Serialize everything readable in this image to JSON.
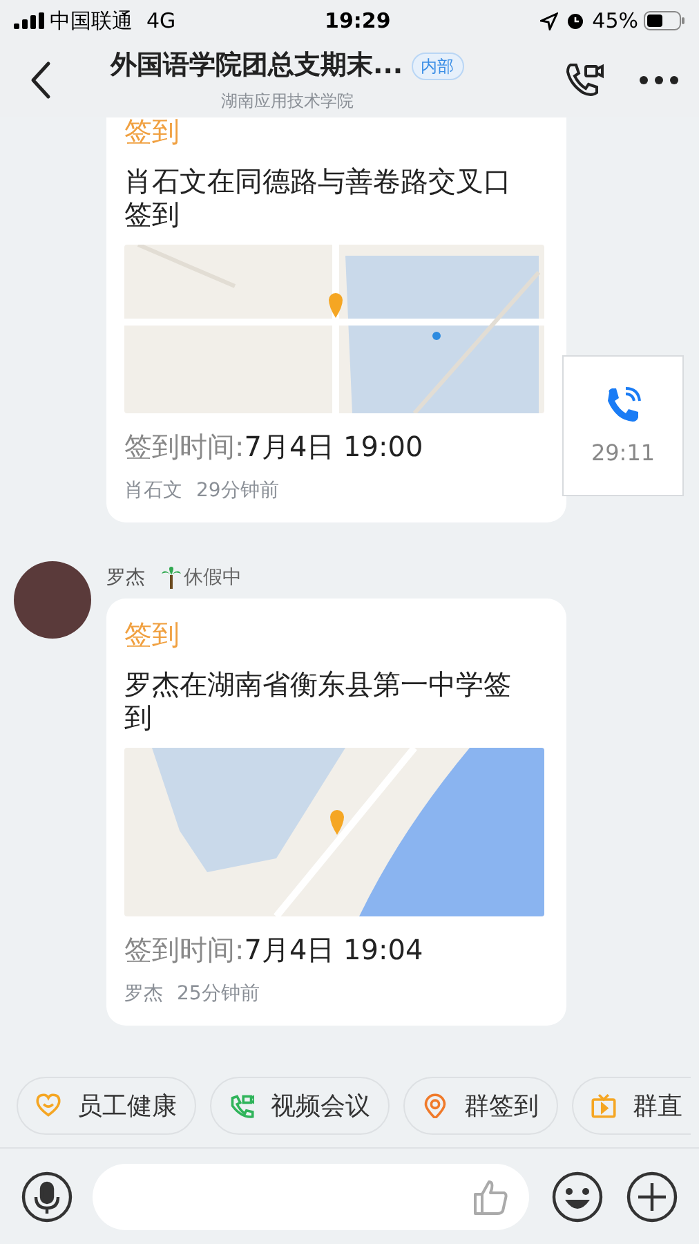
{
  "status_bar": {
    "carrier": "中国联通",
    "network": "4G",
    "time": "19:29",
    "battery": "45%"
  },
  "header": {
    "title": "外国语学院团总支期末...",
    "badge": "内部",
    "subtitle": "湖南应用技术学院"
  },
  "messages": [
    {
      "kind": "checkin",
      "tag": "签到",
      "text": "肖石文在同德路与善卷路交叉口签到",
      "time_label": "签到时间:",
      "time": "7月4日 19:00",
      "footer_name": "肖石文",
      "footer_ago": "29分钟前"
    },
    {
      "kind": "call",
      "duration": "29:11"
    },
    {
      "kind": "checkin",
      "sender": "罗杰",
      "status": "休假中",
      "tag": "签到",
      "text": "罗杰在湖南省衡东县第一中学签到",
      "time_label": "签到时间:",
      "time": "7月4日 19:04",
      "footer_name": "罗杰",
      "footer_ago": "25分钟前"
    }
  ],
  "quick_actions": [
    {
      "kind": "heart",
      "label": "员工健康"
    },
    {
      "kind": "video",
      "label": "视频会议"
    },
    {
      "kind": "pin",
      "label": "群签到"
    },
    {
      "kind": "tv",
      "label": "群直"
    }
  ]
}
